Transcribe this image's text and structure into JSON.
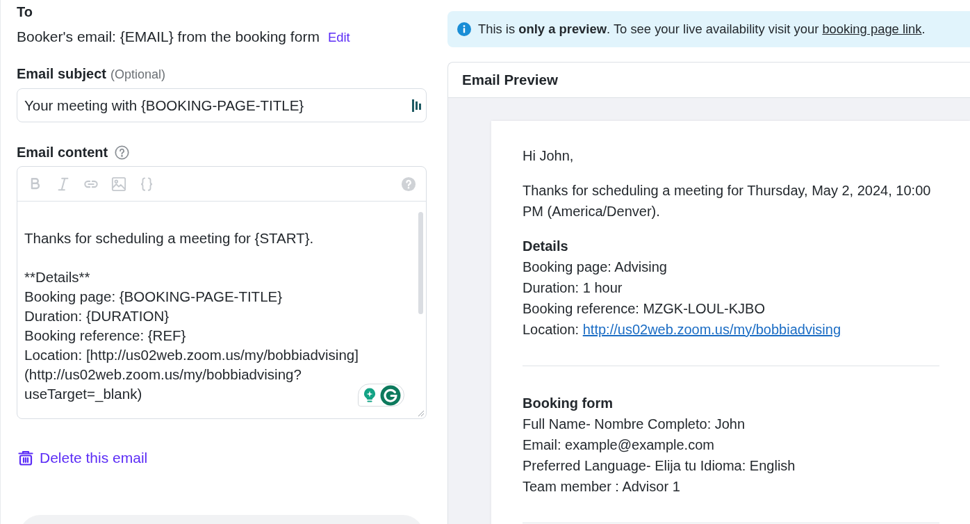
{
  "to": {
    "label": "To",
    "value": "Booker's email: {EMAIL} from the booking form",
    "action": "Edit"
  },
  "subject": {
    "label": "Email subject",
    "hint": "(Optional)",
    "value": "Your meeting with {BOOKING-PAGE-TITLE}"
  },
  "content": {
    "label": "Email content",
    "value": "Thanks for scheduling a meeting for {START}.\n\n**Details**\nBooking page: {BOOKING-PAGE-TITLE}\nDuration: {DURATION}\nBooking reference: {REF}\nLocation: [http://us02web.zoom.us/my/bobbiadvising](http://us02web.zoom.us/my/bobbiadvising?useTarget=_blank)"
  },
  "delete_action": "Delete this email",
  "notice": {
    "text": "This is **only a preview**. To see your live availability visit your ",
    "link": "booking page link",
    "end": "."
  },
  "preview": {
    "title": "Email Preview",
    "greeting": "Hi John,",
    "intro": "Thanks for scheduling a meeting for Thursday, May 2, 2024, 10:00 PM (America/Denver).",
    "sections": [
      {
        "heading": "Details",
        "lines": [
          {
            "kind": "text",
            "text": "Booking page: Advising"
          },
          {
            "kind": "text",
            "text": "Duration: 1 hour"
          },
          {
            "kind": "text",
            "text": "Booking reference: MZGK-LOUL-KJBO"
          },
          {
            "kind": "link",
            "text": "Location: ",
            "link": "http://us02web.zoom.us/my/bobbiadvising"
          }
        ]
      },
      {
        "heading": "Booking form",
        "lines": [
          {
            "kind": "text",
            "text": "Full Name- Nombre Completo: John"
          },
          {
            "kind": "text",
            "text": "Email: example@example.com"
          },
          {
            "kind": "text",
            "text": "Preferred Language- Elija tu Idioma: English"
          },
          {
            "kind": "text",
            "text": "Team member : Advisor 1"
          }
        ]
      }
    ]
  }
}
